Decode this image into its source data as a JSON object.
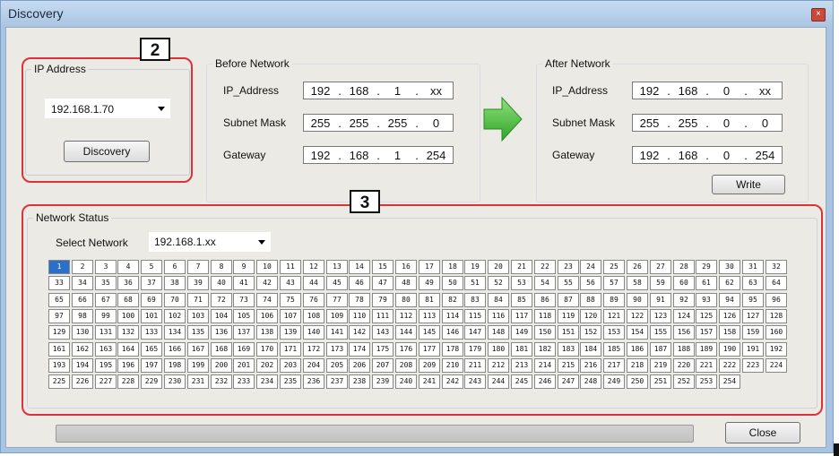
{
  "window": {
    "title": "Discovery",
    "close_glyph": "×"
  },
  "callouts": {
    "first": "2",
    "second": "3"
  },
  "ip_address": {
    "legend": "IP Address",
    "selected": "192.168.1.70",
    "discovery_button": "Discovery"
  },
  "before_network": {
    "legend": "Before Network",
    "ip_label": "IP_Address",
    "subnet_label": "Subnet Mask",
    "gateway_label": "Gateway",
    "ip": [
      "192",
      "168",
      "1",
      "xx"
    ],
    "subnet": [
      "255",
      "255",
      "255",
      "0"
    ],
    "gateway": [
      "192",
      "168",
      "1",
      "254"
    ]
  },
  "after_network": {
    "legend": "After Network",
    "ip_label": "IP_Address",
    "subnet_label": "Subnet Mask",
    "gateway_label": "Gateway",
    "ip": [
      "192",
      "168",
      "0",
      "xx"
    ],
    "subnet": [
      "255",
      "255",
      "0",
      "0"
    ],
    "gateway": [
      "192",
      "168",
      "0",
      "254"
    ],
    "write_button": "Write"
  },
  "network_status": {
    "legend": "Network Status",
    "select_label": "Select Network",
    "selected_network": "192.168.1.xx",
    "selected_host": "1",
    "host_first": 1,
    "host_last": 254
  },
  "footer": {
    "close_button": "Close"
  },
  "colors": {
    "highlight": "#e0303a",
    "arrow": "#3fbf3a",
    "selected_cell": "#2a6fc9"
  },
  "icons": {
    "arrow": "right-arrow-icon",
    "dropdown": "chevron-down-icon",
    "window_close": "close-icon"
  }
}
